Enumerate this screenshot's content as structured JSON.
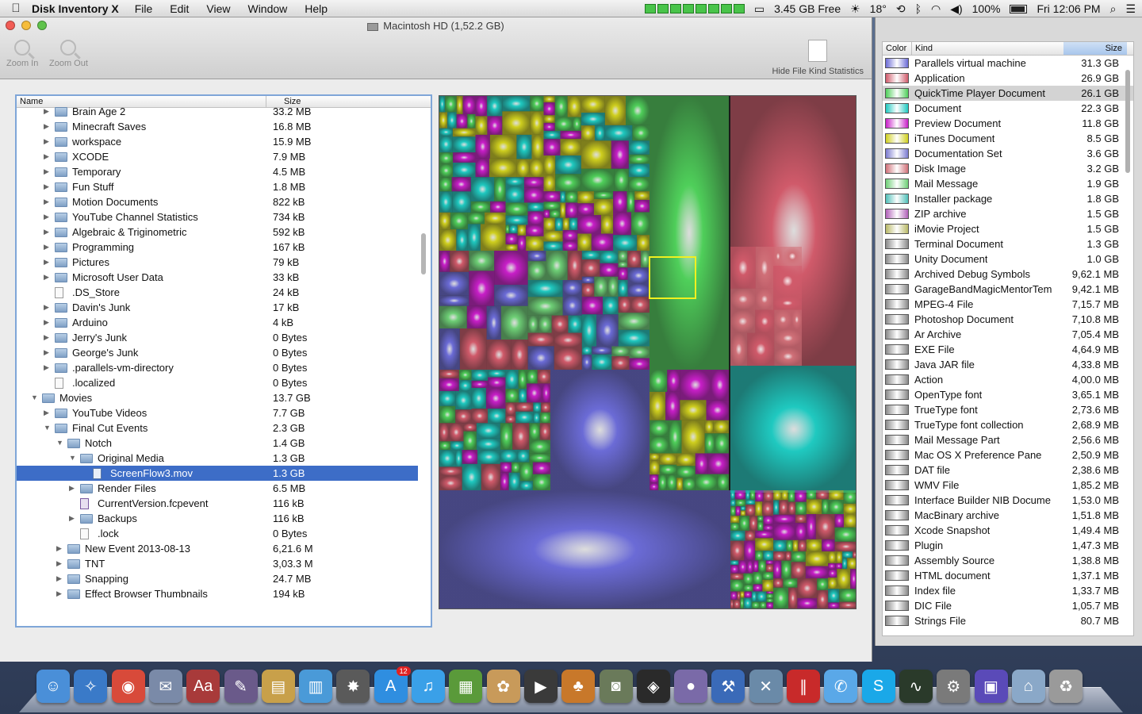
{
  "menubar": {
    "app_name": "Disk Inventory X",
    "menus": [
      "File",
      "Edit",
      "View",
      "Window",
      "Help"
    ],
    "disk_free": "3.45 GB Free",
    "temperature": "18°",
    "battery": "100%",
    "clock": "Fri 12:06 PM"
  },
  "window": {
    "title": "Macintosh HD (1,52.2 GB)",
    "toolbar": {
      "zoom_in": "Zoom In",
      "zoom_out": "Zoom Out",
      "hide_stats": "Hide File Kind Statistics"
    }
  },
  "outline": {
    "columns": {
      "name": "Name",
      "size": "Size"
    },
    "rows": [
      {
        "name": "Brain Age 2",
        "size": "33.2 MB",
        "level": 3,
        "type": "folder",
        "expanded": false
      },
      {
        "name": "Minecraft Saves",
        "size": "16.8 MB",
        "level": 3,
        "type": "folder",
        "expanded": false
      },
      {
        "name": "workspace",
        "size": "15.9 MB",
        "level": 3,
        "type": "folder",
        "expanded": false
      },
      {
        "name": "XCODE",
        "size": "7.9 MB",
        "level": 3,
        "type": "folder",
        "expanded": false
      },
      {
        "name": "Temporary",
        "size": "4.5 MB",
        "level": 3,
        "type": "folder",
        "expanded": false
      },
      {
        "name": "Fun Stuff",
        "size": "1.8 MB",
        "level": 3,
        "type": "folder",
        "expanded": false
      },
      {
        "name": "Motion Documents",
        "size": "822 kB",
        "level": 3,
        "type": "folder",
        "expanded": false
      },
      {
        "name": "YouTube Channel Statistics",
        "size": "734 kB",
        "level": 3,
        "type": "folder",
        "expanded": false
      },
      {
        "name": "Algebraic & Triginometric",
        "size": "592 kB",
        "level": 3,
        "type": "folder",
        "expanded": false
      },
      {
        "name": "Programming",
        "size": "167 kB",
        "level": 3,
        "type": "folder",
        "expanded": false
      },
      {
        "name": "Pictures",
        "size": "79 kB",
        "level": 3,
        "type": "folder",
        "expanded": false
      },
      {
        "name": "Microsoft User Data",
        "size": "33 kB",
        "level": 3,
        "type": "folder",
        "expanded": false
      },
      {
        "name": ".DS_Store",
        "size": "24 kB",
        "level": 3,
        "type": "file"
      },
      {
        "name": "Davin's Junk",
        "size": "17 kB",
        "level": 3,
        "type": "folder",
        "expanded": false
      },
      {
        "name": "Arduino",
        "size": "4 kB",
        "level": 3,
        "type": "folder",
        "expanded": false
      },
      {
        "name": "Jerry's Junk",
        "size": "0 Bytes",
        "level": 3,
        "type": "folder",
        "expanded": false
      },
      {
        "name": "George's Junk",
        "size": "0 Bytes",
        "level": 3,
        "type": "folder",
        "expanded": false
      },
      {
        "name": ".parallels-vm-directory",
        "size": "0 Bytes",
        "level": 3,
        "type": "folder",
        "expanded": false
      },
      {
        "name": ".localized",
        "size": "0 Bytes",
        "level": 3,
        "type": "file"
      },
      {
        "name": "Movies",
        "size": "13.7 GB",
        "level": 2,
        "type": "folder",
        "expanded": true
      },
      {
        "name": "YouTube Videos",
        "size": "7.7 GB",
        "level": 3,
        "type": "folder",
        "expanded": false
      },
      {
        "name": "Final Cut Events",
        "size": "2.3 GB",
        "level": 3,
        "type": "folder",
        "expanded": true
      },
      {
        "name": "Notch",
        "size": "1.4 GB",
        "level": 4,
        "type": "folder",
        "expanded": true
      },
      {
        "name": "Original Media",
        "size": "1.3 GB",
        "level": 5,
        "type": "folder",
        "expanded": true
      },
      {
        "name": "ScreenFlow3.mov",
        "size": "1.3 GB",
        "level": 6,
        "type": "movie",
        "selected": true
      },
      {
        "name": "Render Files",
        "size": "6.5 MB",
        "level": 5,
        "type": "folder",
        "expanded": false
      },
      {
        "name": "CurrentVersion.fcpevent",
        "size": "116 kB",
        "level": 5,
        "type": "fcp"
      },
      {
        "name": "Backups",
        "size": "116 kB",
        "level": 5,
        "type": "folder",
        "expanded": false
      },
      {
        "name": ".lock",
        "size": "0 Bytes",
        "level": 5,
        "type": "file"
      },
      {
        "name": "New Event 2013-08-13",
        "size": "6,21.6 M",
        "level": 4,
        "type": "folder",
        "expanded": false
      },
      {
        "name": "TNT",
        "size": "3,03.3 M",
        "level": 4,
        "type": "folder",
        "expanded": false
      },
      {
        "name": "Snapping",
        "size": "24.7 MB",
        "level": 4,
        "type": "folder",
        "expanded": false
      },
      {
        "name": "Effect Browser Thumbnails",
        "size": "194 kB",
        "level": 4,
        "type": "folder",
        "expanded": false
      }
    ]
  },
  "stats": {
    "columns": {
      "color": "Color",
      "kind": "Kind",
      "size": "Size"
    },
    "rows": [
      {
        "kind": "Parallels virtual machine",
        "size": "31.3 GB",
        "color": "#6b6bd6"
      },
      {
        "kind": "Application",
        "size": "26.9 GB",
        "color": "#d05a6a"
      },
      {
        "kind": "QuickTime Player Document",
        "size": "26.1 GB",
        "color": "#4fcf5a",
        "selected": true
      },
      {
        "kind": "Document",
        "size": "22.3 GB",
        "color": "#1fc9c0"
      },
      {
        "kind": "Preview Document",
        "size": "11.8 GB",
        "color": "#c81ec8"
      },
      {
        "kind": "iTunes Document",
        "size": "8.5 GB",
        "color": "#cfcf1e"
      },
      {
        "kind": "Documentation Set",
        "size": "3.6 GB",
        "color": "#7a7ad0"
      },
      {
        "kind": "Disk Image",
        "size": "3.2 GB",
        "color": "#d07078"
      },
      {
        "kind": "Mail Message",
        "size": "1.9 GB",
        "color": "#6ecf76"
      },
      {
        "kind": "Installer package",
        "size": "1.8 GB",
        "color": "#4fbfb8"
      },
      {
        "kind": "ZIP archive",
        "size": "1.5 GB",
        "color": "#b060b8"
      },
      {
        "kind": "iMovie Project",
        "size": "1.5 GB",
        "color": "#b8b866"
      },
      {
        "kind": "Terminal Document",
        "size": "1.3 GB",
        "color": "#8a8a8a"
      },
      {
        "kind": "Unity Document",
        "size": "1.0 GB",
        "color": "#8a8a8a"
      },
      {
        "kind": "Archived Debug Symbols",
        "size": "9,62.1 MB",
        "color": "#8a8a8a"
      },
      {
        "kind": "GarageBandMagicMentorTem",
        "size": "9,42.1 MB",
        "color": "#8a8a8a"
      },
      {
        "kind": "MPEG-4 File",
        "size": "7,15.7 MB",
        "color": "#8a8a8a"
      },
      {
        "kind": "Photoshop Document",
        "size": "7,10.8 MB",
        "color": "#8a8a8a"
      },
      {
        "kind": "Ar Archive",
        "size": "7,05.4 MB",
        "color": "#8a8a8a"
      },
      {
        "kind": "EXE File",
        "size": "4,64.9 MB",
        "color": "#8a8a8a"
      },
      {
        "kind": "Java JAR file",
        "size": "4,33.8 MB",
        "color": "#8a8a8a"
      },
      {
        "kind": "Action",
        "size": "4,00.0 MB",
        "color": "#8a8a8a"
      },
      {
        "kind": "OpenType font",
        "size": "3,65.1 MB",
        "color": "#8a8a8a"
      },
      {
        "kind": "TrueType font",
        "size": "2,73.6 MB",
        "color": "#8a8a8a"
      },
      {
        "kind": "TrueType font collection",
        "size": "2,68.9 MB",
        "color": "#8a8a8a"
      },
      {
        "kind": "Mail Message Part",
        "size": "2,56.6 MB",
        "color": "#8a8a8a"
      },
      {
        "kind": "Mac OS X Preference Pane",
        "size": "2,50.9 MB",
        "color": "#8a8a8a"
      },
      {
        "kind": "DAT file",
        "size": "2,38.6 MB",
        "color": "#8a8a8a"
      },
      {
        "kind": "WMV File",
        "size": "1,85.2 MB",
        "color": "#8a8a8a"
      },
      {
        "kind": "Interface Builder NIB Docume",
        "size": "1,53.0 MB",
        "color": "#8a8a8a"
      },
      {
        "kind": "MacBinary archive",
        "size": "1,51.8 MB",
        "color": "#8a8a8a"
      },
      {
        "kind": "Xcode Snapshot",
        "size": "1,49.4 MB",
        "color": "#8a8a8a"
      },
      {
        "kind": "Plugin",
        "size": "1,47.3 MB",
        "color": "#8a8a8a"
      },
      {
        "kind": "Assembly Source",
        "size": "1,38.8 MB",
        "color": "#8a8a8a"
      },
      {
        "kind": "HTML document",
        "size": "1,37.1 MB",
        "color": "#8a8a8a"
      },
      {
        "kind": "Index file",
        "size": "1,33.7 MB",
        "color": "#8a8a8a"
      },
      {
        "kind": "DIC File",
        "size": "1,05.7 MB",
        "color": "#8a8a8a"
      },
      {
        "kind": "Strings File",
        "size": "80.7 MB",
        "color": "#8a8a8a"
      }
    ]
  },
  "treemap": {
    "selected_color": "#f0f020"
  },
  "dock": {
    "app_store_badge": "12",
    "icons": [
      {
        "name": "finder-icon",
        "glyph": "☺",
        "color": "#4a8fd8"
      },
      {
        "name": "safari-icon",
        "glyph": "✧",
        "color": "#3a7ac8"
      },
      {
        "name": "chrome-icon",
        "glyph": "◉",
        "color": "#d84a3a"
      },
      {
        "name": "mail-icon",
        "glyph": "✉",
        "color": "#7a8aa8"
      },
      {
        "name": "dictionary-icon",
        "glyph": "Aa",
        "color": "#a83a3a"
      },
      {
        "name": "quill-icon",
        "glyph": "✎",
        "color": "#6a5a8a"
      },
      {
        "name": "presentation-icon",
        "glyph": "▤",
        "color": "#c8a04a"
      },
      {
        "name": "numbers-icon",
        "glyph": "▥",
        "color": "#4a9ad8"
      },
      {
        "name": "movie-clapper-icon",
        "glyph": "✸",
        "color": "#5a5a5a"
      },
      {
        "name": "app-store-icon",
        "glyph": "A",
        "color": "#2f8ee0"
      },
      {
        "name": "itunes-icon",
        "glyph": "♫",
        "color": "#3aa0e8"
      },
      {
        "name": "minecraft-icon",
        "glyph": "▦",
        "color": "#5a9a3a"
      },
      {
        "name": "photo-editor-icon",
        "glyph": "✿",
        "color": "#c89a5a"
      },
      {
        "name": "final-cut-icon",
        "glyph": "▶",
        "color": "#3a3a3a"
      },
      {
        "name": "cocktail-icon",
        "glyph": "♣",
        "color": "#c8782a"
      },
      {
        "name": "iphoto-icon",
        "glyph": "◙",
        "color": "#6a7a5a"
      },
      {
        "name": "unity-icon",
        "glyph": "◈",
        "color": "#2a2a2a"
      },
      {
        "name": "sphere-app-icon",
        "glyph": "●",
        "color": "#7a6aa8"
      },
      {
        "name": "xcode-icon",
        "glyph": "⚒",
        "color": "#3a6ab8"
      },
      {
        "name": "utility-tools-icon",
        "glyph": "✕",
        "color": "#6a8aa8"
      },
      {
        "name": "parallels-icon",
        "glyph": "∥",
        "color": "#c82a2a"
      },
      {
        "name": "messages-icon",
        "glyph": "✆",
        "color": "#5aa8e8"
      },
      {
        "name": "skype-icon",
        "glyph": "S",
        "color": "#1aa8e8"
      },
      {
        "name": "activity-monitor-icon",
        "glyph": "∿",
        "color": "#2a3a2a"
      },
      {
        "name": "system-preferences-icon",
        "glyph": "⚙",
        "color": "#7a7a7a"
      },
      {
        "name": "disk-inventory-icon",
        "glyph": "▣",
        "color": "#5a4ab8"
      },
      {
        "name": "applications-folder-icon",
        "glyph": "⌂",
        "color": "#8aa8c8"
      },
      {
        "name": "trash-icon",
        "glyph": "♻",
        "color": "#9a9a9a"
      }
    ]
  }
}
